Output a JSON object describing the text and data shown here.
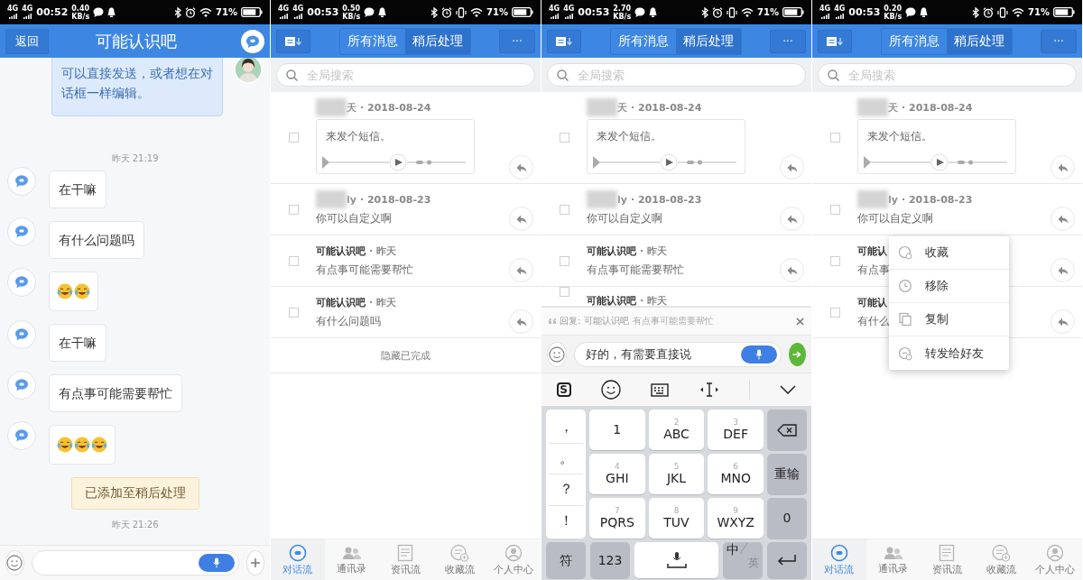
{
  "panels": [
    {
      "kind": "chat",
      "status": {
        "networks": [
          "4G",
          "4G"
        ],
        "time": "00:52",
        "speed": "0.40",
        "speed_unit": "KB/s",
        "vibrate": false,
        "battery": "71%"
      },
      "header": {
        "back": "返回",
        "title": "可能认识吧"
      },
      "messages": [
        {
          "kind": "sent",
          "text": "可以直接发送，或者想在对话框一样编辑。"
        },
        {
          "kind": "time",
          "text": "昨天 21:19"
        },
        {
          "kind": "received",
          "text": "在干嘛"
        },
        {
          "kind": "received",
          "text": "有什么问题吗"
        },
        {
          "kind": "stickers",
          "stickers": [
            {
              "kind": "laugh"
            },
            {
              "kind": "laugh"
            }
          ]
        },
        {
          "kind": "received",
          "text": "在干嘛"
        },
        {
          "kind": "received",
          "text": "有点事可能需要帮忙"
        },
        {
          "kind": "stickers",
          "stickers": [
            {
              "kind": "laugh"
            },
            {
              "kind": "laugh"
            },
            {
              "kind": "laugh"
            }
          ]
        },
        {
          "kind": "toast",
          "text": "已添加至稍后处理"
        },
        {
          "kind": "time",
          "text": "昨天 21:26"
        }
      ]
    },
    {
      "kind": "inbox",
      "status": {
        "networks": [
          "4G",
          "4G"
        ],
        "time": "00:53",
        "speed": "0.50",
        "speed_unit": "KB/s",
        "vibrate": true,
        "battery": "71%"
      },
      "tabs": [
        {
          "label": "所有消息",
          "selected": false
        },
        {
          "label": "稍后处理",
          "selected": true
        }
      ],
      "more": "···",
      "search": {
        "placeholder": "全局搜索"
      },
      "items": [
        {
          "kind": "voice",
          "checked": false,
          "blurred": true,
          "sender": "天",
          "when": "· 2018-08-24",
          "text": "来发个短信。"
        },
        {
          "kind": "text",
          "checked": false,
          "blurred": true,
          "sender": "ly",
          "when": "· 2018-08-23",
          "text": "你可以自定义啊"
        },
        {
          "kind": "text",
          "checked": false,
          "blurred": false,
          "sender": "可能认识吧",
          "when": "· 昨天",
          "text": "有点事可能需要帮忙"
        },
        {
          "kind": "text",
          "checked": false,
          "blurred": false,
          "sender": "可能认识吧",
          "when": "· 昨天",
          "text": "有什么问题吗"
        }
      ],
      "footer": "隐藏已完成",
      "tab_bar": [
        {
          "label": "对话流",
          "kind": "chat",
          "selected": true
        },
        {
          "label": "通讯录",
          "kind": "contacts",
          "selected": false
        },
        {
          "label": "资讯流",
          "kind": "news",
          "selected": false
        },
        {
          "label": "收藏流",
          "kind": "favorites",
          "selected": false
        },
        {
          "label": "个人中心",
          "kind": "profile",
          "selected": false
        }
      ]
    },
    {
      "kind": "inbox",
      "status": {
        "networks": [
          "4G",
          "4G"
        ],
        "time": "00:53",
        "speed": "2.70",
        "speed_unit": "KB/s",
        "vibrate": true,
        "battery": "71%"
      },
      "tabs": [
        {
          "label": "所有消息",
          "selected": false
        },
        {
          "label": "稍后处理",
          "selected": true
        }
      ],
      "more": "···",
      "search": {
        "placeholder": "全局搜索"
      },
      "items": [
        {
          "kind": "voice",
          "checked": false,
          "blurred": true,
          "sender": "天",
          "when": "· 2018-08-24",
          "text": "来发个短信。"
        },
        {
          "kind": "text",
          "checked": false,
          "blurred": true,
          "sender": "ly",
          "when": "· 2018-08-23",
          "text": "你可以自定义啊"
        },
        {
          "kind": "text",
          "checked": false,
          "blurred": false,
          "sender": "可能认识吧",
          "when": "· 昨天",
          "text": "有点事可能需要帮忙"
        },
        {
          "kind": "partial",
          "checked": false,
          "blurred": false,
          "sender": "可能认识吧",
          "when": "· 昨天"
        }
      ],
      "composer": {
        "reply_label": "回复: 可能认识吧",
        "reply_text": "有点事可能需要帮忙",
        "value": "好的，有需要直接说",
        "toolbar": [
          {
            "kind": "logo",
            "text": "S"
          },
          {
            "kind": "emoji"
          },
          {
            "kind": "keyboard"
          },
          {
            "kind": "cursor"
          },
          {
            "kind": "collapse"
          }
        ],
        "punctuation": [
          "，",
          "。",
          "？",
          "！"
        ],
        "keys": [
          {
            "kind": "key",
            "main": "1"
          },
          {
            "kind": "key",
            "sup": "2",
            "main": "ABC"
          },
          {
            "kind": "key",
            "sup": "3",
            "main": "DEF"
          },
          {
            "kind": "backspace"
          },
          {
            "kind": "key",
            "sup": "4",
            "main": "GHI"
          },
          {
            "kind": "key",
            "sup": "5",
            "main": "JKL"
          },
          {
            "kind": "key",
            "sup": "6",
            "main": "MNO"
          },
          {
            "kind": "function",
            "main": "重输"
          },
          {
            "kind": "key",
            "sup": "7",
            "main": "PQRS"
          },
          {
            "kind": "key",
            "sup": "8",
            "main": "TUV"
          },
          {
            "kind": "key",
            "sup": "9",
            "main": "WXYZ"
          },
          {
            "kind": "function",
            "main": "0"
          }
        ],
        "bottom_keys": [
          {
            "kind": "function",
            "main": "符"
          },
          {
            "kind": "function",
            "main": "123"
          },
          {
            "kind": "space"
          },
          {
            "kind": "lang",
            "main": "中",
            "sub": "英"
          },
          {
            "kind": "enter"
          }
        ]
      }
    },
    {
      "kind": "inbox",
      "status": {
        "networks": [
          "4G",
          "4G"
        ],
        "time": "00:53",
        "speed": "0.20",
        "speed_unit": "KB/s",
        "vibrate": true,
        "battery": "71%"
      },
      "tabs": [
        {
          "label": "所有消息",
          "selected": false
        },
        {
          "label": "稍后处理",
          "selected": true
        }
      ],
      "more": "···",
      "search": {
        "placeholder": "全局搜索"
      },
      "items": [
        {
          "kind": "voice",
          "checked": false,
          "blurred": true,
          "sender": "天",
          "when": "· 2018-08-24",
          "text": "来发个短信。"
        },
        {
          "kind": "text",
          "checked": false,
          "blurred": true,
          "sender": "ly",
          "when": "· 2018-08-23",
          "text": "你可以自定义啊"
        },
        {
          "kind": "text",
          "checked": false,
          "blurred": false,
          "sender": "可能认",
          "text": "有点事"
        },
        {
          "kind": "text",
          "checked": false,
          "blurred": false,
          "sender": "可能认",
          "text": "有什么"
        }
      ],
      "menu": [
        {
          "kind": "favorite",
          "label": "收藏"
        },
        {
          "kind": "remove",
          "label": "移除"
        },
        {
          "kind": "copy",
          "label": "复制"
        },
        {
          "kind": "forward",
          "label": "转发给好友"
        }
      ],
      "tab_bar": [
        {
          "label": "对话流",
          "kind": "chat",
          "selected": true
        },
        {
          "label": "通讯录",
          "kind": "contacts",
          "selected": false
        },
        {
          "label": "资讯流",
          "kind": "news",
          "selected": false
        },
        {
          "label": "收藏流",
          "kind": "favorites",
          "selected": false
        },
        {
          "label": "个人中心",
          "kind": "profile",
          "selected": false
        }
      ]
    }
  ]
}
